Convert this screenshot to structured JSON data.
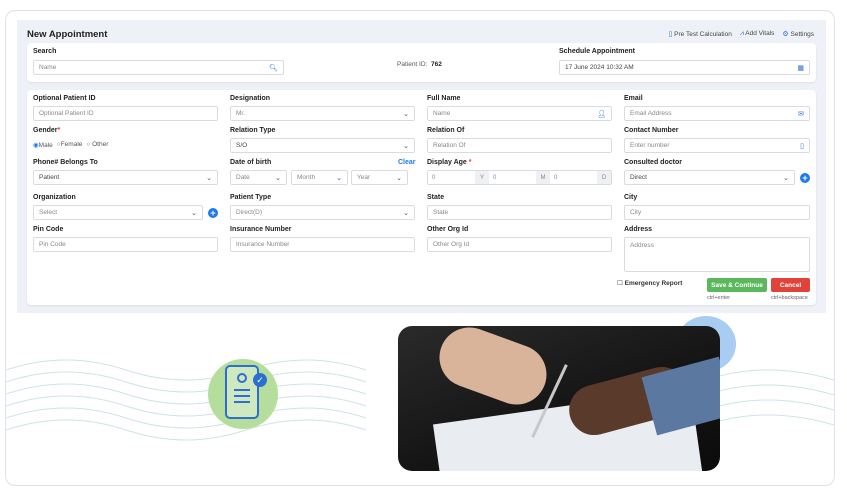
{
  "title": "New Appointment",
  "toolbar": {
    "pretest": "Pre Test Calculation",
    "vitals": "Add Vitals",
    "settings": "Settings"
  },
  "search": {
    "label": "Search",
    "placeholder": "Name"
  },
  "patient_id": {
    "label": "Patient ID:",
    "value": "762"
  },
  "schedule": {
    "label": "Schedule Appointment",
    "value": "17 June 2024 10:32 AM"
  },
  "fields": {
    "optional_id": {
      "label": "Optional Patient ID",
      "placeholder": "Optional Patient ID"
    },
    "designation": {
      "label": "Designation",
      "value": "Mr."
    },
    "full_name": {
      "label": "Full Name",
      "placeholder": "Name"
    },
    "email": {
      "label": "Email",
      "placeholder": "Email Address"
    },
    "gender": {
      "label": "Gender",
      "required": "*",
      "options": [
        "Male",
        "Female",
        "Other"
      ],
      "selected": "Male"
    },
    "relation_type": {
      "label": "Relation Type",
      "value": "S/O"
    },
    "relation_of": {
      "label": "Relation Of",
      "placeholder": "Relation Of"
    },
    "contact": {
      "label": "Contact Number",
      "placeholder": "Enter number"
    },
    "phone_belongs": {
      "label": "Phone# Belongs To",
      "value": "Patient"
    },
    "dob": {
      "label": "Date of birth",
      "clear": "Clear",
      "date": "Date",
      "month": "Month",
      "year": "Year"
    },
    "age": {
      "label": "Display Age",
      "required": "*",
      "y": "0",
      "y_unit": "Y",
      "m": "0",
      "m_unit": "M",
      "d": "0",
      "d_unit": "D"
    },
    "doctor": {
      "label": "Consulted doctor",
      "value": "Direct"
    },
    "organization": {
      "label": "Organization",
      "value": "Select"
    },
    "patient_type": {
      "label": "Patient Type",
      "value": "Direct(D)"
    },
    "state": {
      "label": "State",
      "placeholder": "State"
    },
    "city": {
      "label": "City",
      "placeholder": "City"
    },
    "pin": {
      "label": "Pin Code",
      "placeholder": "Pin Code"
    },
    "insurance": {
      "label": "Insurance Number",
      "placeholder": "Insurance Number"
    },
    "other_org": {
      "label": "Other Org Id",
      "placeholder": "Other Org Id"
    },
    "address": {
      "label": "Address",
      "placeholder": "Address"
    }
  },
  "emergency": "Emergency Report",
  "save": {
    "label": "Save & Continue",
    "hint": "ctrl+enter",
    "color": "#5cb85c"
  },
  "cancel": {
    "label": "Cancel",
    "hint": "ctrl+backspace",
    "color": "#e0433a"
  }
}
